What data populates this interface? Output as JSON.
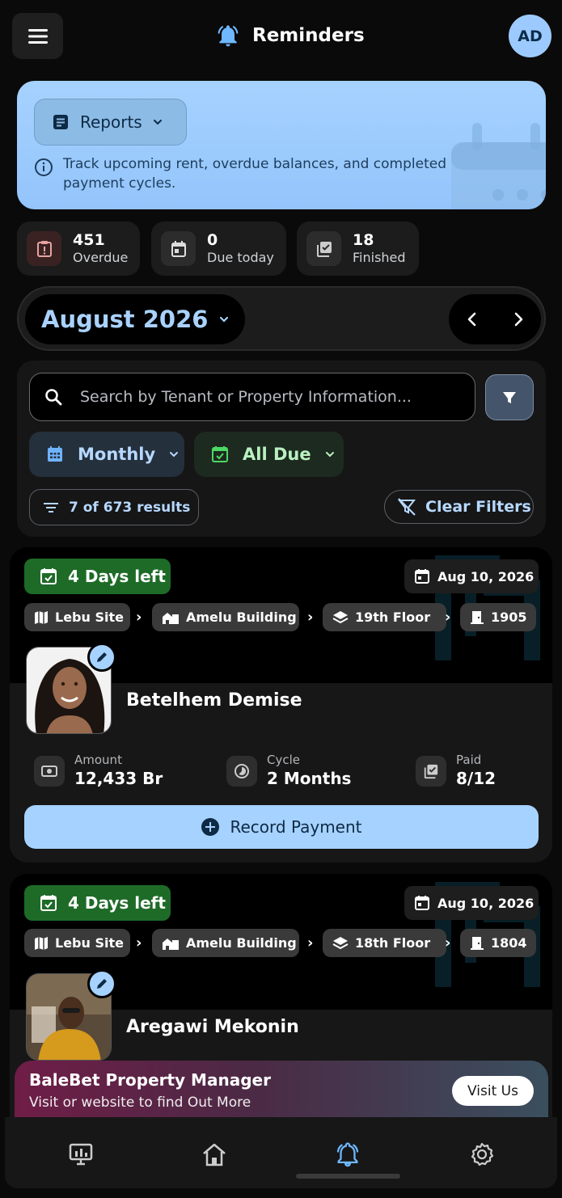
{
  "header": {
    "title": "Reminders",
    "avatar_initials": "AD"
  },
  "banner": {
    "reports_label": "Reports",
    "info_text": "Track upcoming rent, overdue balances, and completed payment cycles."
  },
  "stats": [
    {
      "value": "451",
      "label": "Overdue"
    },
    {
      "value": "0",
      "label": "Due today"
    },
    {
      "value": "18",
      "label": "Finished"
    }
  ],
  "month_selector": {
    "label": "August 2026"
  },
  "filters": {
    "search_placeholder": "Search by Tenant or Property Information...",
    "period_label": "Monthly",
    "status_label": "All Due",
    "results_label": "7 of 673 results",
    "clear_label": "Clear Filters"
  },
  "cards": [
    {
      "due_badge": "4 Days left",
      "date": "Aug 10, 2026",
      "site": "Lebu Site",
      "building": "Amelu Building",
      "floor": "19th Floor",
      "unit": "1905",
      "tenant": "Betelhem Demise",
      "amount_label": "Amount",
      "amount": "12,433 Br",
      "cycle_label": "Cycle",
      "cycle": "2 Months",
      "paid_label": "Paid",
      "paid": "8/12",
      "action": "Record Payment"
    },
    {
      "due_badge": "4 Days left",
      "date": "Aug 10, 2026",
      "site": "Lebu Site",
      "building": "Amelu Building",
      "floor": "18th Floor",
      "unit": "1804",
      "tenant": "Aregawi Mekonin"
    }
  ],
  "promo": {
    "title": "BaleBet Property Manager",
    "subtitle": "Visit or website to find Out More",
    "button": "Visit Us"
  },
  "colors": {
    "accent": "#a6d2ff",
    "due_badge": "#1e6b28",
    "background": "#0a0a0a"
  }
}
